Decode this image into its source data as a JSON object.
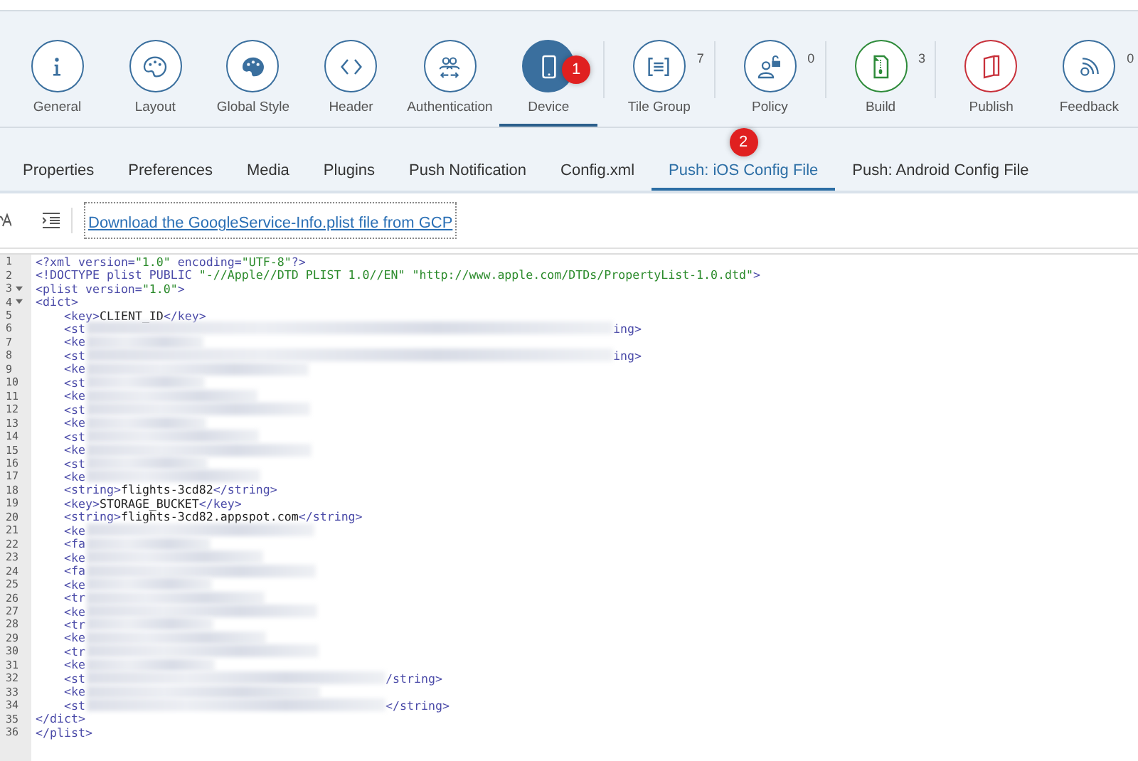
{
  "top_toolbar": [
    {
      "label": "General",
      "selected": false,
      "color": "#3a6f9e"
    },
    {
      "label": "Layout",
      "selected": false,
      "color": "#3a6f9e"
    },
    {
      "label": "Global Style",
      "selected": false,
      "color": "#3a6f9e"
    },
    {
      "label": "Header",
      "selected": false,
      "color": "#3a6f9e"
    },
    {
      "label": "Authentication",
      "selected": false,
      "color": "#3a6f9e"
    },
    {
      "label": "Device",
      "selected": true,
      "color": "#3a6f9e",
      "badge": "1"
    },
    {
      "label": "Tile Group",
      "selected": false,
      "color": "#3a6f9e",
      "count": "7"
    },
    {
      "label": "Policy",
      "selected": false,
      "color": "#3a6f9e",
      "count": "0"
    },
    {
      "label": "Build",
      "selected": false,
      "color": "#2e8b3a",
      "count": "3"
    },
    {
      "label": "Publish",
      "selected": false,
      "color": "#c8303a"
    },
    {
      "label": "Feedback",
      "selected": false,
      "color": "#3a6f9e",
      "count": "0"
    }
  ],
  "tabs": [
    {
      "label": "Properties",
      "selected": false
    },
    {
      "label": "Preferences",
      "selected": false
    },
    {
      "label": "Media",
      "selected": false
    },
    {
      "label": "Plugins",
      "selected": false
    },
    {
      "label": "Push Notification",
      "selected": false
    },
    {
      "label": "Config.xml",
      "selected": false
    },
    {
      "label": "Push: iOS Config File",
      "selected": true,
      "badge": "2"
    },
    {
      "label": "Push: Android Config File",
      "selected": false
    }
  ],
  "editor_toolbar": {
    "download_link": "Download the GoogleService-Info.plist file from GCP"
  },
  "editor": {
    "lines": [
      {
        "number": "1",
        "code": "<?xml version=\"1.0\" encoding=\"UTF-8\"?>"
      },
      {
        "number": "2",
        "code": "<!DOCTYPE plist PUBLIC \"-//Apple//DTD PLIST 1.0//EN\" \"http://www.apple.com/DTDs/PropertyList-1.0.dtd\">"
      },
      {
        "number": "3",
        "code": "<plist version=\"1.0\">",
        "foldable": true
      },
      {
        "number": "4",
        "code": "<dict>",
        "foldable": true
      },
      {
        "number": "5",
        "code": "    <key>CLIENT_ID</key>"
      },
      {
        "number": "6",
        "code": "    <st",
        "redacted": true,
        "tail": "ing>"
      },
      {
        "number": "7",
        "code": "    <ke",
        "redacted": true
      },
      {
        "number": "8",
        "code": "    <st",
        "redacted": true,
        "tail": "ing>"
      },
      {
        "number": "9",
        "code": "    <ke",
        "redacted": true
      },
      {
        "number": "10",
        "code": "    <st",
        "redacted": true
      },
      {
        "number": "11",
        "code": "    <ke",
        "redacted": true
      },
      {
        "number": "12",
        "code": "    <st",
        "redacted": true
      },
      {
        "number": "13",
        "code": "    <ke",
        "redacted": true
      },
      {
        "number": "14",
        "code": "    <st",
        "redacted": true
      },
      {
        "number": "15",
        "code": "    <ke",
        "redacted": true
      },
      {
        "number": "16",
        "code": "    <st",
        "redacted": true
      },
      {
        "number": "17",
        "code": "    <ke",
        "redacted": true
      },
      {
        "number": "18",
        "code": "    <string>flights-3cd82</string>"
      },
      {
        "number": "19",
        "code": "    <key>STORAGE_BUCKET</key>"
      },
      {
        "number": "20",
        "code": "    <string>flights-3cd82.appspot.com</string>"
      },
      {
        "number": "21",
        "code": "    <ke",
        "redacted": true
      },
      {
        "number": "22",
        "code": "    <fa",
        "redacted": true
      },
      {
        "number": "23",
        "code": "    <ke",
        "redacted": true
      },
      {
        "number": "24",
        "code": "    <fa",
        "redacted": true
      },
      {
        "number": "25",
        "code": "    <ke",
        "redacted": true
      },
      {
        "number": "26",
        "code": "    <tr",
        "redacted": true
      },
      {
        "number": "27",
        "code": "    <ke",
        "redacted": true
      },
      {
        "number": "28",
        "code": "    <tr",
        "redacted": true
      },
      {
        "number": "29",
        "code": "    <ke",
        "redacted": true
      },
      {
        "number": "30",
        "code": "    <tr",
        "redacted": true
      },
      {
        "number": "31",
        "code": "    <ke",
        "redacted": true
      },
      {
        "number": "32",
        "code": "    <st",
        "redacted": true,
        "tail": "/string>"
      },
      {
        "number": "33",
        "code": "    <ke",
        "redacted": true
      },
      {
        "number": "34",
        "code": "    <st",
        "redacted": true,
        "tail": "</string>"
      },
      {
        "number": "35",
        "code": "</dict>"
      },
      {
        "number": "36",
        "code": "</plist>"
      }
    ]
  }
}
